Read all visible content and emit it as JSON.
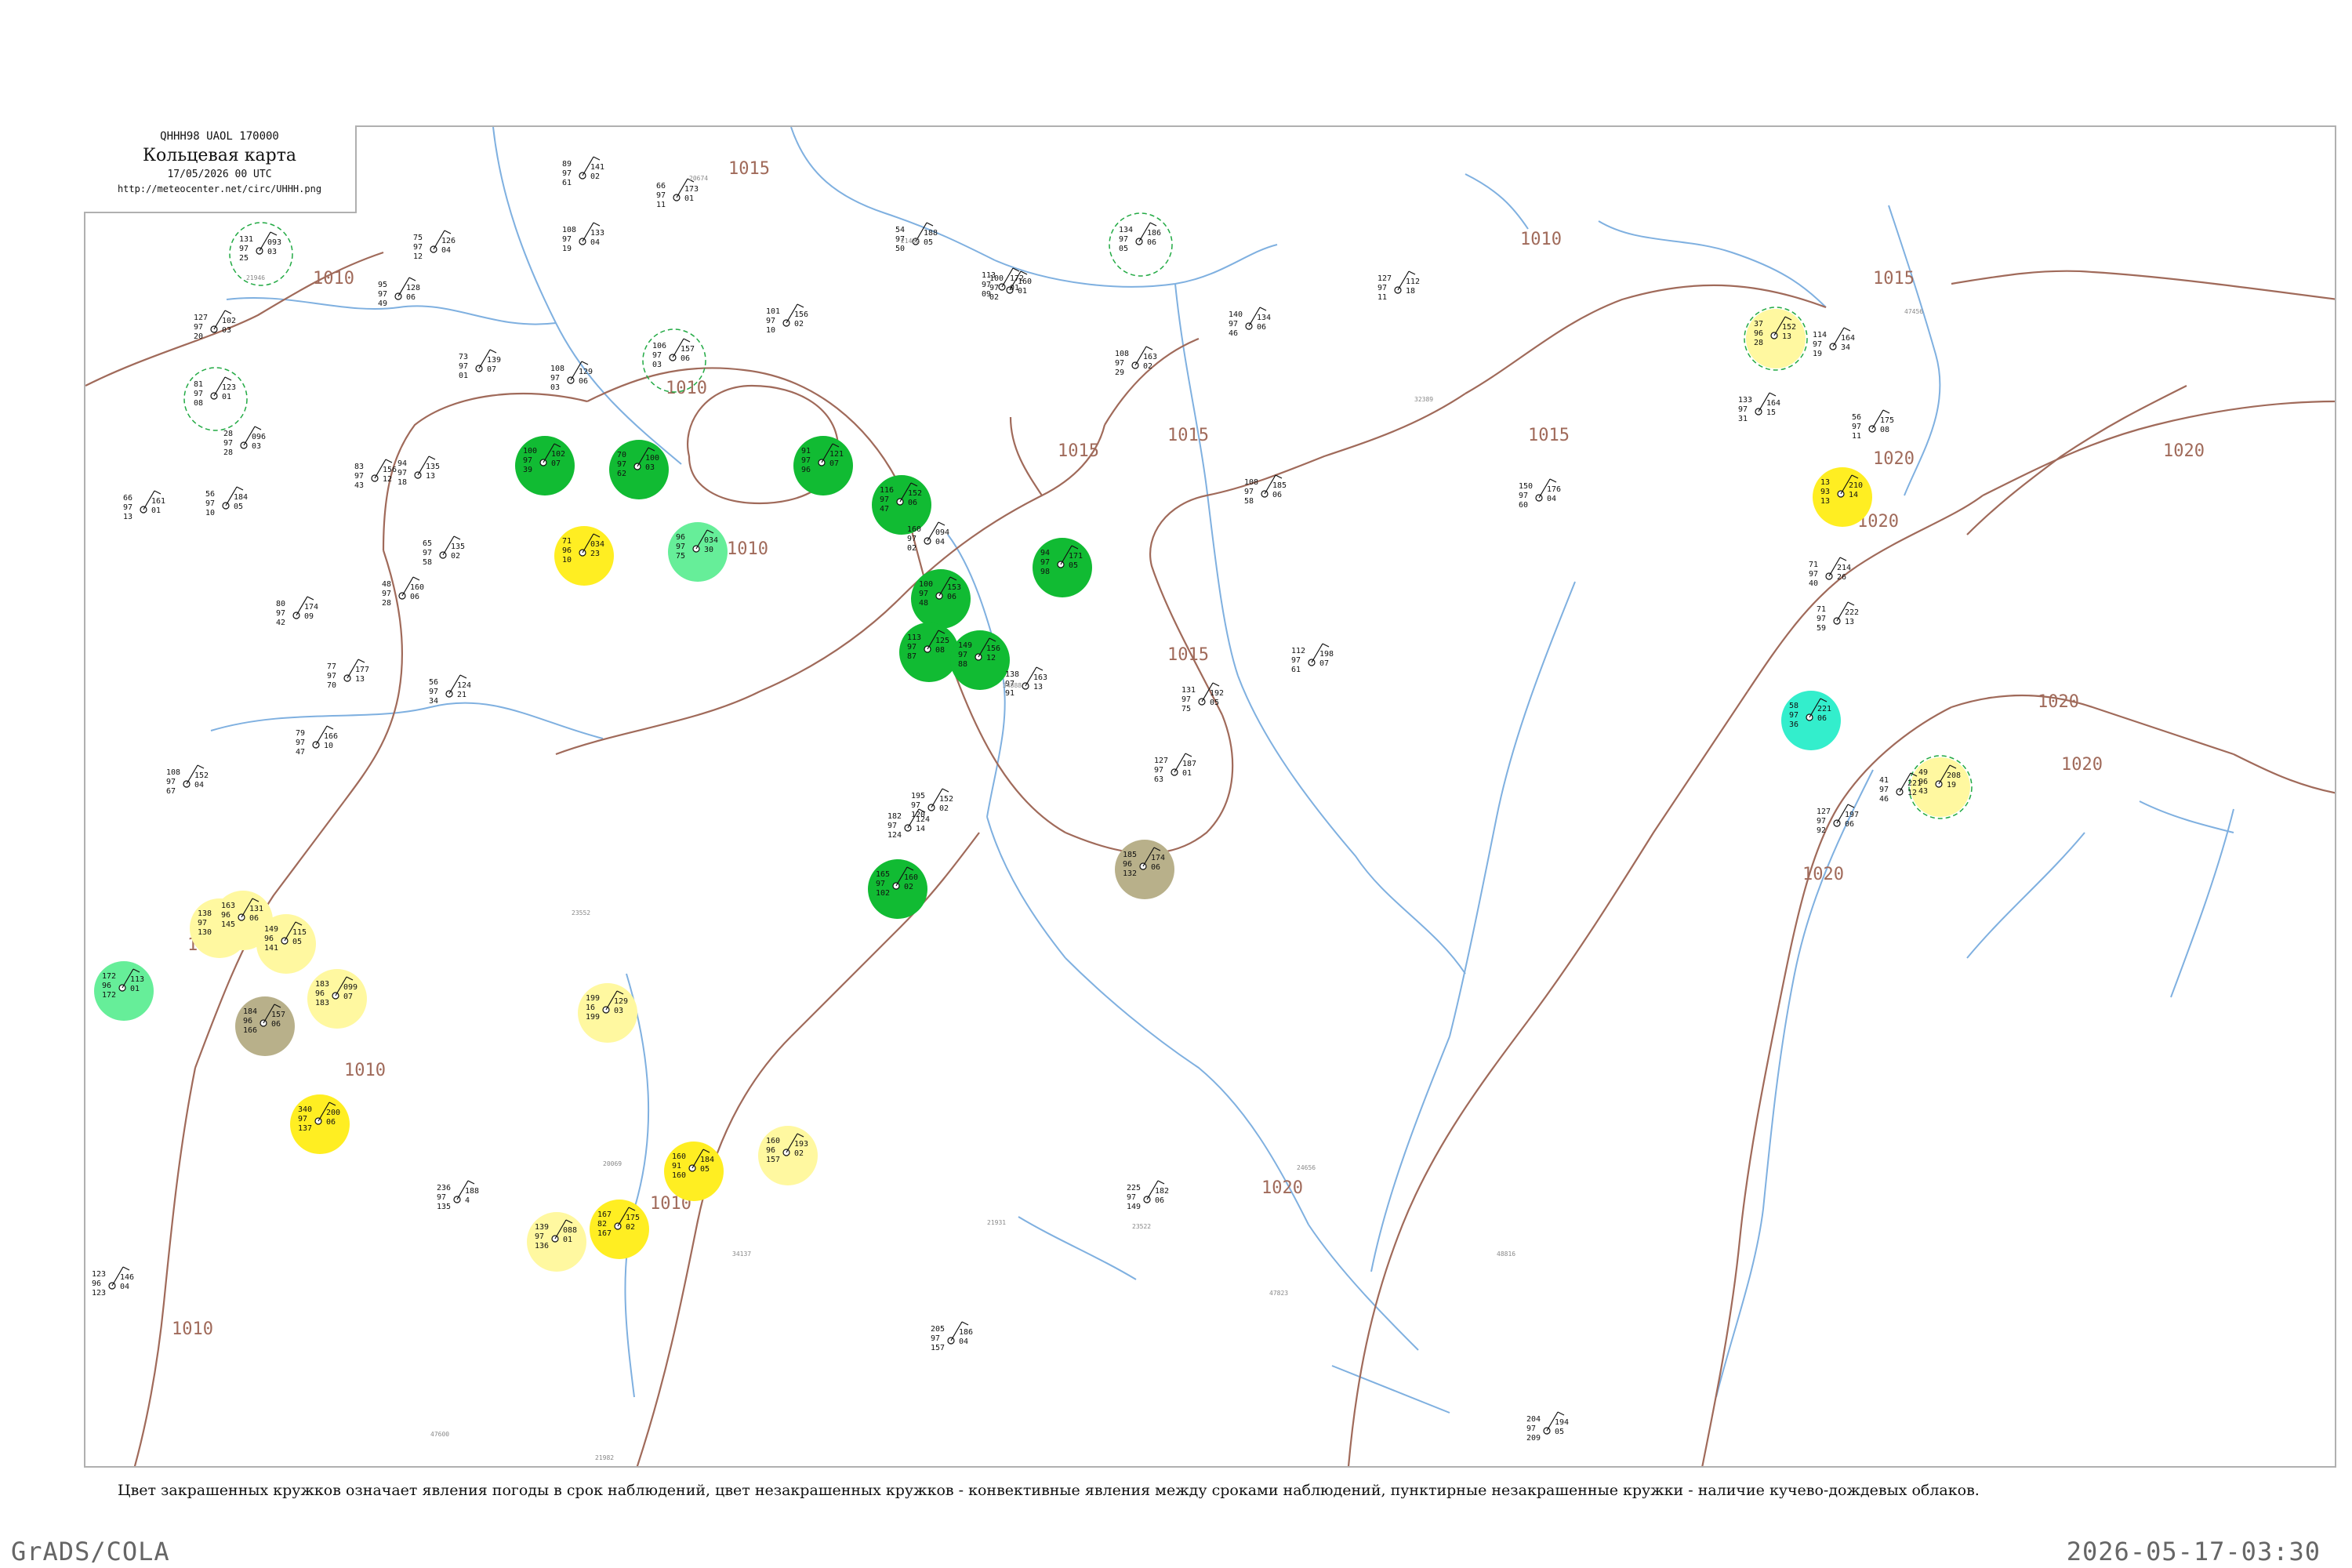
{
  "header": {
    "code": "QHHH98  UAOL  170000",
    "name": "Кольцевая карта",
    "date": "17/05/2026 00 UTC",
    "url": "http://meteocenter.net/circ/UHHH.png"
  },
  "legend_note": "Цвет закрашенных кружков означает явления погоды в срок наблюдений, цвет незакрашенных кружков - конвективные явления между сроками наблюдений, пунктирные незакрашенные кружки - наличие кучево-дождевых облаков.",
  "footer": {
    "left": "GrADS/COLA",
    "right": "2026-05-17-03:30"
  },
  "colors": {
    "isobar": "#a06a5a",
    "river": "#7fb0e0",
    "rain_green": "#11bb33",
    "yellow": "#ffee22",
    "light_yellow": "#fff8a0",
    "cyan": "#33eecc",
    "olive": "#b8b08a",
    "light_green": "#66ee99"
  },
  "isobars": [
    {
      "label": "1015"
    },
    {
      "label": "1010"
    },
    {
      "label": "1010"
    },
    {
      "label": "1010"
    },
    {
      "label": "1015"
    },
    {
      "label": "1015"
    },
    {
      "label": "1020"
    },
    {
      "label": "1020"
    },
    {
      "label": "1015"
    },
    {
      "label": "1010"
    },
    {
      "label": "1020"
    },
    {
      "label": "1020"
    },
    {
      "label": "1020"
    },
    {
      "label": "1010"
    },
    {
      "label": "1010"
    },
    {
      "label": "1015"
    },
    {
      "label": "1010"
    },
    {
      "label": "1020"
    },
    {
      "label": "1010"
    },
    {
      "label": "1015"
    },
    {
      "label": "1020"
    }
  ],
  "stations": [
    {
      "top": "131",
      "mid": "97",
      "bot": "25",
      "right": "093",
      "rmid": "03",
      "fill": "none",
      "dashed": true
    },
    {
      "top": "127",
      "mid": "97",
      "bot": "20",
      "right": "102",
      "rmid": "03",
      "fill": "none"
    },
    {
      "top": "81",
      "mid": "97",
      "bot": "08",
      "right": "123",
      "rmid": "01",
      "fill": "none",
      "dashed": true
    },
    {
      "top": "28",
      "mid": "97",
      "bot": "28",
      "right": "096",
      "rmid": "03",
      "fill": "none"
    },
    {
      "top": "95",
      "mid": "97",
      "bot": "49",
      "right": "128",
      "rmid": "06",
      "fill": "none"
    },
    {
      "top": "75",
      "mid": "97",
      "bot": "12",
      "right": "126",
      "rmid": "04",
      "fill": "none"
    },
    {
      "top": "89",
      "mid": "97",
      "bot": "61",
      "right": "141",
      "rmid": "02",
      "fill": "none"
    },
    {
      "top": "66",
      "mid": "97",
      "bot": "11",
      "right": "173",
      "rmid": "01",
      "fill": "none"
    },
    {
      "top": "108",
      "mid": "97",
      "bot": "19",
      "right": "133",
      "rmid": "04",
      "fill": "none"
    },
    {
      "top": "106",
      "mid": "97",
      "bot": "03",
      "right": "157",
      "rmid": "06",
      "fill": "none",
      "dashed": true
    },
    {
      "top": "73",
      "mid": "97",
      "bot": "01",
      "right": "139",
      "rmid": "07",
      "fill": "none"
    },
    {
      "top": "108",
      "mid": "97",
      "bot": "03",
      "right": "129",
      "rmid": "06",
      "fill": "none"
    },
    {
      "top": "66",
      "mid": "97",
      "bot": "13",
      "right": "161",
      "rmid": "01",
      "fill": "none"
    },
    {
      "top": "83",
      "mid": "97",
      "bot": "43",
      "right": "156",
      "rmid": "12",
      "fill": "none"
    },
    {
      "top": "94",
      "mid": "97",
      "bot": "18",
      "right": "135",
      "rmid": "13",
      "fill": "none"
    },
    {
      "top": "56",
      "mid": "97",
      "bot": "10",
      "right": "184",
      "rmid": "05",
      "fill": "none"
    },
    {
      "top": "65",
      "mid": "97",
      "bot": "58",
      "right": "135",
      "rmid": "02",
      "fill": "none"
    },
    {
      "top": "48",
      "mid": "97",
      "bot": "28",
      "right": "160",
      "rmid": "06",
      "fill": "none"
    },
    {
      "top": "80",
      "mid": "97",
      "bot": "42",
      "right": "174",
      "rmid": "09",
      "fill": "none"
    },
    {
      "top": "77",
      "mid": "97",
      "bot": "70",
      "right": "177",
      "rmid": "13",
      "fill": "none"
    },
    {
      "top": "56",
      "mid": "97",
      "bot": "34",
      "right": "124",
      "rmid": "21",
      "fill": "none"
    },
    {
      "top": "79",
      "mid": "97",
      "bot": "47",
      "right": "166",
      "rmid": "10",
      "fill": "none"
    },
    {
      "top": "108",
      "mid": "97",
      "bot": "67",
      "right": "152",
      "rmid": "04",
      "fill": "none"
    },
    {
      "top": "71",
      "mid": "96",
      "bot": "10",
      "right": "034",
      "rmid": "23",
      "fill": "yellow"
    },
    {
      "top": "100",
      "mid": "97",
      "bot": "39",
      "right": "102",
      "rmid": "07",
      "fill": "green"
    },
    {
      "top": "70",
      "mid": "97",
      "bot": "62",
      "right": "100",
      "rmid": "03",
      "fill": "green"
    },
    {
      "top": "96",
      "mid": "97",
      "bot": "75",
      "right": "034",
      "rmid": "30",
      "fill": "lightgreen"
    },
    {
      "top": "91",
      "mid": "97",
      "bot": "96",
      "right": "121",
      "rmid": "07",
      "fill": "green"
    },
    {
      "top": "116",
      "mid": "97",
      "bot": "47",
      "right": "152",
      "rmid": "06",
      "fill": "green"
    },
    {
      "top": "100",
      "mid": "97",
      "bot": "48",
      "right": "153",
      "rmid": "06",
      "fill": "green"
    },
    {
      "top": "94",
      "mid": "97",
      "bot": "98",
      "right": "171",
      "rmid": "05",
      "fill": "green"
    },
    {
      "top": "113",
      "mid": "97",
      "bot": "87",
      "right": "125",
      "rmid": "08",
      "fill": "green"
    },
    {
      "top": "149",
      "mid": "97",
      "bot": "88",
      "right": "156",
      "rmid": "12",
      "fill": "green"
    },
    {
      "top": "160",
      "mid": "97",
      "bot": "02",
      "right": "094",
      "rmid": "04",
      "fill": "none"
    },
    {
      "top": "134",
      "mid": "97",
      "bot": "05",
      "right": "186",
      "rmid": "06",
      "fill": "none",
      "dashed": true
    },
    {
      "top": "100",
      "mid": "97",
      "bot": "02",
      "right": "160",
      "rmid": "01",
      "fill": "none"
    },
    {
      "top": "101",
      "mid": "97",
      "bot": "10",
      "right": "156",
      "rmid": "02",
      "fill": "none"
    },
    {
      "top": "54",
      "mid": "97",
      "bot": "50",
      "right": "188",
      "rmid": "05",
      "fill": "none"
    },
    {
      "top": "113",
      "mid": "97",
      "bot": "09",
      "right": "172",
      "rmid": "01",
      "fill": "none"
    },
    {
      "top": "108",
      "mid": "97",
      "bot": "29",
      "right": "163",
      "rmid": "02",
      "fill": "none"
    },
    {
      "top": "140",
      "mid": "97",
      "bot": "46",
      "right": "134",
      "rmid": "06",
      "fill": "none"
    },
    {
      "top": "127",
      "mid": "97",
      "bot": "11",
      "right": "112",
      "rmid": "18",
      "fill": "none"
    },
    {
      "top": "108",
      "mid": "97",
      "bot": "58",
      "right": "185",
      "rmid": "06",
      "fill": "none"
    },
    {
      "top": "37",
      "mid": "96",
      "bot": "28",
      "right": "152",
      "rmid": "13",
      "fill": "lightyellow",
      "dashed": true
    },
    {
      "top": "114",
      "mid": "97",
      "bot": "19",
      "right": "164",
      "rmid": "34",
      "fill": "none"
    },
    {
      "top": "133",
      "mid": "97",
      "bot": "31",
      "right": "164",
      "rmid": "15",
      "fill": "none"
    },
    {
      "top": "56",
      "mid": "97",
      "bot": "11",
      "right": "175",
      "rmid": "08",
      "fill": "none"
    },
    {
      "top": "13",
      "mid": "93",
      "bot": "13",
      "right": "210",
      "rmid": "14",
      "fill": "yellow"
    },
    {
      "top": "150",
      "mid": "97",
      "bot": "60",
      "right": "176",
      "rmid": "04",
      "fill": "none"
    },
    {
      "top": "71",
      "mid": "97",
      "bot": "40",
      "right": "214",
      "rmid": "26",
      "fill": "none"
    },
    {
      "top": "71",
      "mid": "97",
      "bot": "59",
      "right": "222",
      "rmid": "13",
      "fill": "none"
    },
    {
      "top": "58",
      "mid": "97",
      "bot": "36",
      "right": "221",
      "rmid": "06",
      "fill": "cyan"
    },
    {
      "top": "49",
      "mid": "96",
      "bot": "43",
      "right": "208",
      "rmid": "19",
      "fill": "lightyellow",
      "dashed": true
    },
    {
      "top": "41",
      "mid": "97",
      "bot": "46",
      "right": "221",
      "rmid": "12",
      "fill": "none"
    },
    {
      "top": "127",
      "mid": "97",
      "bot": "92",
      "right": "197",
      "rmid": "06",
      "fill": "none"
    },
    {
      "top": "185",
      "mid": "96",
      "bot": "132",
      "right": "174",
      "rmid": "06",
      "fill": "olive"
    },
    {
      "top": "138",
      "mid": "97",
      "bot": "91",
      "right": "163",
      "rmid": "13",
      "fill": "none"
    },
    {
      "top": "112",
      "mid": "97",
      "bot": "61",
      "right": "198",
      "rmid": "07",
      "fill": "none"
    },
    {
      "top": "131",
      "mid": "97",
      "bot": "75",
      "right": "192",
      "rmid": "05",
      "fill": "none"
    },
    {
      "top": "127",
      "mid": "97",
      "bot": "63",
      "right": "187",
      "rmid": "01",
      "fill": "none"
    },
    {
      "top": "195",
      "mid": "97",
      "bot": "120",
      "right": "152",
      "rmid": "02",
      "fill": "none"
    },
    {
      "top": "182",
      "mid": "97",
      "bot": "124",
      "right": "124",
      "rmid": "14",
      "fill": "none"
    },
    {
      "top": "165",
      "mid": "97",
      "bot": "102",
      "right": "160",
      "rmid": "02",
      "fill": "green"
    },
    {
      "top": "138",
      "mid": "97",
      "bot": "130",
      "right": "133",
      "rmid": "06",
      "fill": "lightyellow"
    },
    {
      "top": "163",
      "mid": "96",
      "bot": "145",
      "right": "131",
      "rmid": "06",
      "fill": "lightyellow"
    },
    {
      "top": "149",
      "mid": "96",
      "bot": "141",
      "right": "115",
      "rmid": "05",
      "fill": "lightyellow"
    },
    {
      "top": "172",
      "mid": "96",
      "bot": "172",
      "right": "113",
      "rmid": "01",
      "fill": "lightgreen"
    },
    {
      "top": "183",
      "mid": "96",
      "bot": "183",
      "right": "099",
      "rmid": "07",
      "fill": "lightyellow"
    },
    {
      "top": "184",
      "mid": "96",
      "bot": "166",
      "right": "157",
      "rmid": "06",
      "fill": "olive"
    },
    {
      "top": "199",
      "mid": "16",
      "bot": "199",
      "right": "129",
      "rmid": "03",
      "fill": "lightyellow"
    },
    {
      "top": "340",
      "mid": "97",
      "bot": "137",
      "right": "200",
      "rmid": "06",
      "fill": "yellow"
    },
    {
      "top": "160",
      "mid": "96",
      "bot": "157",
      "right": "193",
      "rmid": "02",
      "fill": "lightyellow"
    },
    {
      "top": "160",
      "mid": "91",
      "bot": "160",
      "right": "184",
      "rmid": "05",
      "fill": "yellow"
    },
    {
      "top": "167",
      "mid": "82",
      "bot": "167",
      "right": "175",
      "rmid": "02",
      "fill": "yellow"
    },
    {
      "top": "139",
      "mid": "97",
      "bot": "136",
      "right": "088",
      "rmid": "01",
      "fill": "lightyellow"
    },
    {
      "top": "123",
      "mid": "96",
      "bot": "123",
      "right": "146",
      "rmid": "04",
      "fill": "none"
    },
    {
      "top": "236",
      "mid": "97",
      "bot": "135",
      "right": "188",
      "rmid": "4",
      "fill": "none"
    },
    {
      "top": "225",
      "mid": "97",
      "bot": "149",
      "right": "182",
      "rmid": "06",
      "fill": "none"
    },
    {
      "top": "204",
      "mid": "97",
      "bot": "209",
      "right": "194",
      "rmid": "05",
      "fill": "none"
    },
    {
      "top": "205",
      "mid": "97",
      "bot": "157",
      "right": "186",
      "rmid": "04",
      "fill": "none"
    }
  ],
  "small_labels": [
    "21946",
    "20674",
    "21432",
    "47456",
    "32389",
    "23552",
    "34888",
    "20069",
    "21931",
    "24656",
    "34137",
    "23522",
    "47823",
    "48816",
    "47600",
    "21982"
  ]
}
